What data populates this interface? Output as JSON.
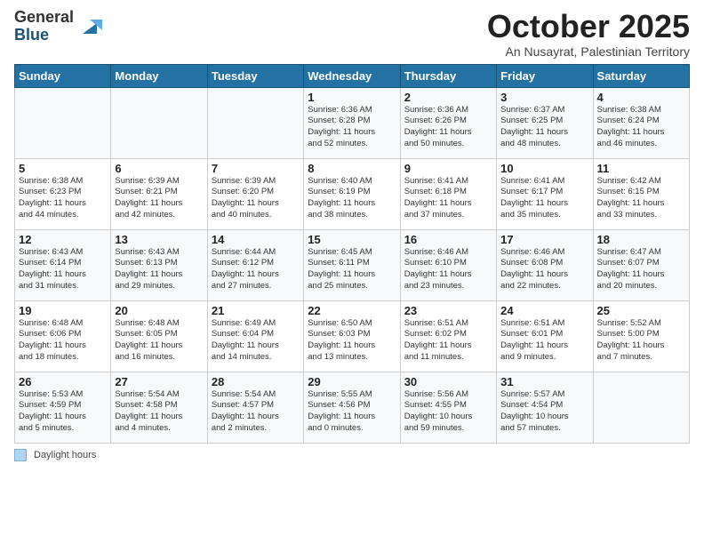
{
  "header": {
    "logo_general": "General",
    "logo_blue": "Blue",
    "month_title": "October 2025",
    "location": "An Nusayrat, Palestinian Territory"
  },
  "days_of_week": [
    "Sunday",
    "Monday",
    "Tuesday",
    "Wednesday",
    "Thursday",
    "Friday",
    "Saturday"
  ],
  "footer": {
    "legend_label": "Daylight hours"
  },
  "weeks": [
    [
      {
        "num": "",
        "info": ""
      },
      {
        "num": "",
        "info": ""
      },
      {
        "num": "",
        "info": ""
      },
      {
        "num": "1",
        "info": "Sunrise: 6:36 AM\nSunset: 6:28 PM\nDaylight: 11 hours\nand 52 minutes."
      },
      {
        "num": "2",
        "info": "Sunrise: 6:36 AM\nSunset: 6:26 PM\nDaylight: 11 hours\nand 50 minutes."
      },
      {
        "num": "3",
        "info": "Sunrise: 6:37 AM\nSunset: 6:25 PM\nDaylight: 11 hours\nand 48 minutes."
      },
      {
        "num": "4",
        "info": "Sunrise: 6:38 AM\nSunset: 6:24 PM\nDaylight: 11 hours\nand 46 minutes."
      }
    ],
    [
      {
        "num": "5",
        "info": "Sunrise: 6:38 AM\nSunset: 6:23 PM\nDaylight: 11 hours\nand 44 minutes."
      },
      {
        "num": "6",
        "info": "Sunrise: 6:39 AM\nSunset: 6:21 PM\nDaylight: 11 hours\nand 42 minutes."
      },
      {
        "num": "7",
        "info": "Sunrise: 6:39 AM\nSunset: 6:20 PM\nDaylight: 11 hours\nand 40 minutes."
      },
      {
        "num": "8",
        "info": "Sunrise: 6:40 AM\nSunset: 6:19 PM\nDaylight: 11 hours\nand 38 minutes."
      },
      {
        "num": "9",
        "info": "Sunrise: 6:41 AM\nSunset: 6:18 PM\nDaylight: 11 hours\nand 37 minutes."
      },
      {
        "num": "10",
        "info": "Sunrise: 6:41 AM\nSunset: 6:17 PM\nDaylight: 11 hours\nand 35 minutes."
      },
      {
        "num": "11",
        "info": "Sunrise: 6:42 AM\nSunset: 6:15 PM\nDaylight: 11 hours\nand 33 minutes."
      }
    ],
    [
      {
        "num": "12",
        "info": "Sunrise: 6:43 AM\nSunset: 6:14 PM\nDaylight: 11 hours\nand 31 minutes."
      },
      {
        "num": "13",
        "info": "Sunrise: 6:43 AM\nSunset: 6:13 PM\nDaylight: 11 hours\nand 29 minutes."
      },
      {
        "num": "14",
        "info": "Sunrise: 6:44 AM\nSunset: 6:12 PM\nDaylight: 11 hours\nand 27 minutes."
      },
      {
        "num": "15",
        "info": "Sunrise: 6:45 AM\nSunset: 6:11 PM\nDaylight: 11 hours\nand 25 minutes."
      },
      {
        "num": "16",
        "info": "Sunrise: 6:46 AM\nSunset: 6:10 PM\nDaylight: 11 hours\nand 23 minutes."
      },
      {
        "num": "17",
        "info": "Sunrise: 6:46 AM\nSunset: 6:08 PM\nDaylight: 11 hours\nand 22 minutes."
      },
      {
        "num": "18",
        "info": "Sunrise: 6:47 AM\nSunset: 6:07 PM\nDaylight: 11 hours\nand 20 minutes."
      }
    ],
    [
      {
        "num": "19",
        "info": "Sunrise: 6:48 AM\nSunset: 6:06 PM\nDaylight: 11 hours\nand 18 minutes."
      },
      {
        "num": "20",
        "info": "Sunrise: 6:48 AM\nSunset: 6:05 PM\nDaylight: 11 hours\nand 16 minutes."
      },
      {
        "num": "21",
        "info": "Sunrise: 6:49 AM\nSunset: 6:04 PM\nDaylight: 11 hours\nand 14 minutes."
      },
      {
        "num": "22",
        "info": "Sunrise: 6:50 AM\nSunset: 6:03 PM\nDaylight: 11 hours\nand 13 minutes."
      },
      {
        "num": "23",
        "info": "Sunrise: 6:51 AM\nSunset: 6:02 PM\nDaylight: 11 hours\nand 11 minutes."
      },
      {
        "num": "24",
        "info": "Sunrise: 6:51 AM\nSunset: 6:01 PM\nDaylight: 11 hours\nand 9 minutes."
      },
      {
        "num": "25",
        "info": "Sunrise: 5:52 AM\nSunset: 5:00 PM\nDaylight: 11 hours\nand 7 minutes."
      }
    ],
    [
      {
        "num": "26",
        "info": "Sunrise: 5:53 AM\nSunset: 4:59 PM\nDaylight: 11 hours\nand 5 minutes."
      },
      {
        "num": "27",
        "info": "Sunrise: 5:54 AM\nSunset: 4:58 PM\nDaylight: 11 hours\nand 4 minutes."
      },
      {
        "num": "28",
        "info": "Sunrise: 5:54 AM\nSunset: 4:57 PM\nDaylight: 11 hours\nand 2 minutes."
      },
      {
        "num": "29",
        "info": "Sunrise: 5:55 AM\nSunset: 4:56 PM\nDaylight: 11 hours\nand 0 minutes."
      },
      {
        "num": "30",
        "info": "Sunrise: 5:56 AM\nSunset: 4:55 PM\nDaylight: 10 hours\nand 59 minutes."
      },
      {
        "num": "31",
        "info": "Sunrise: 5:57 AM\nSunset: 4:54 PM\nDaylight: 10 hours\nand 57 minutes."
      },
      {
        "num": "",
        "info": ""
      }
    ]
  ]
}
